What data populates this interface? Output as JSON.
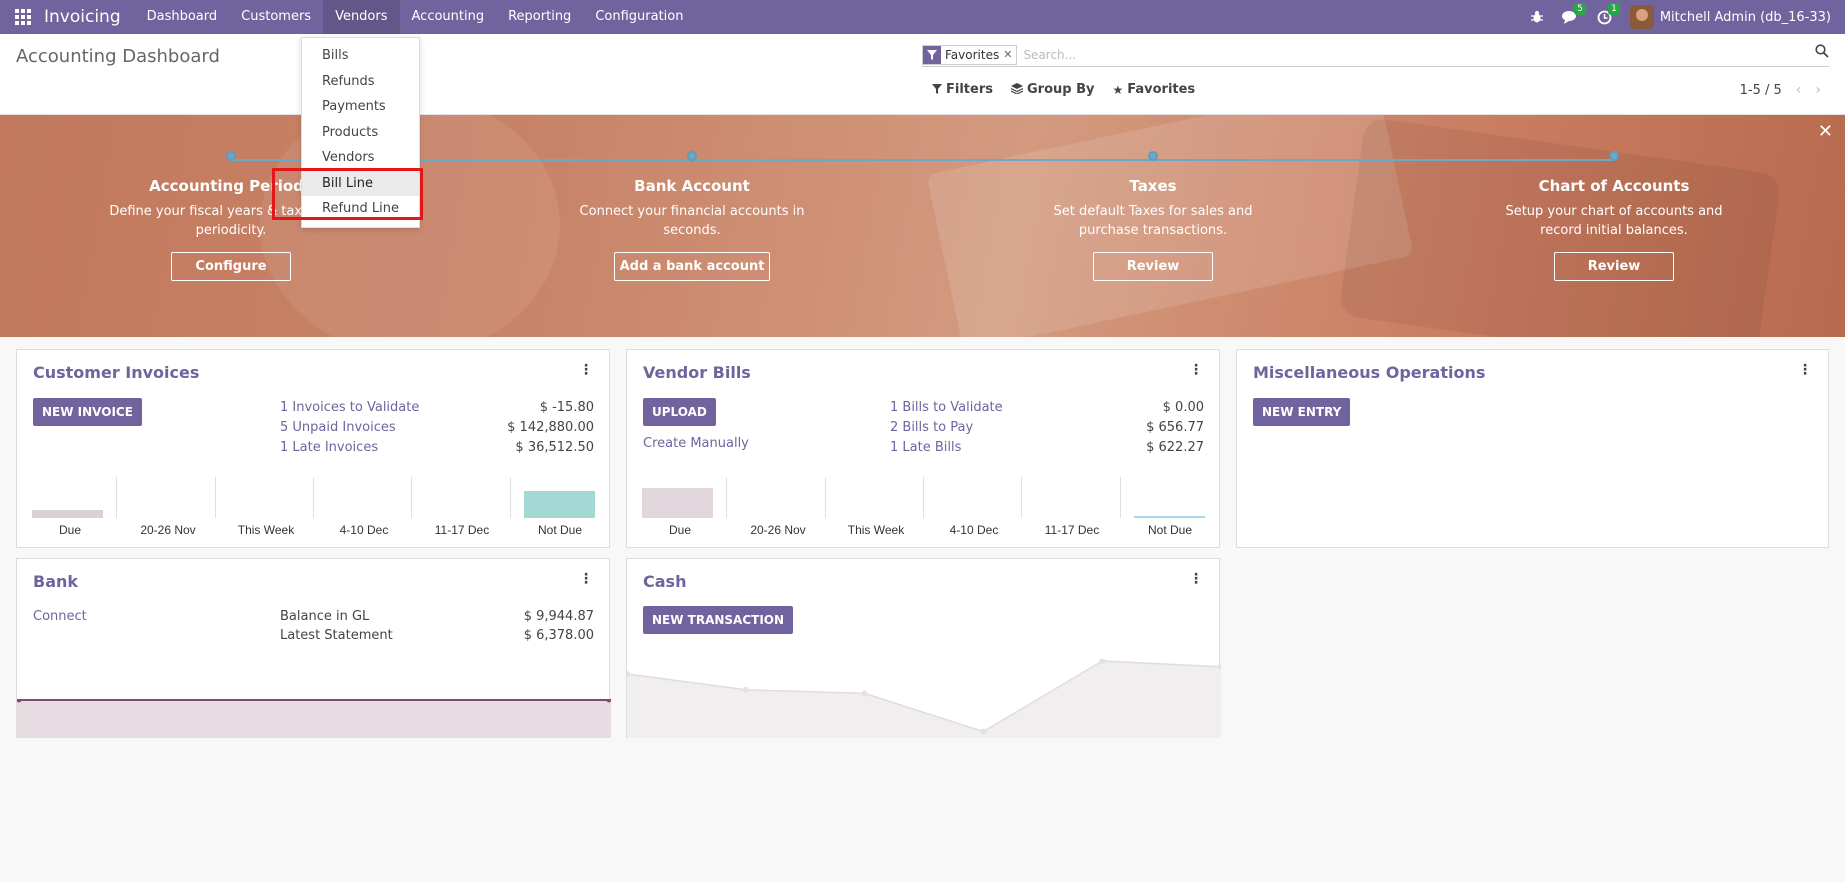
{
  "navbar": {
    "brand": "Invoicing",
    "menu": [
      "Dashboard",
      "Customers",
      "Vendors",
      "Accounting",
      "Reporting",
      "Configuration"
    ],
    "messages_count": "5",
    "activities_count": "1",
    "user": "Mitchell Admin (db_16-33)"
  },
  "control_panel": {
    "title": "Accounting Dashboard",
    "facet": "Favorites",
    "search_placeholder": "Search...",
    "filters": "Filters",
    "group_by": "Group By",
    "favorites": "Favorites",
    "pager": "1-5 / 5"
  },
  "vendors_menu": {
    "items": [
      "Bills",
      "Refunds",
      "Payments",
      "Products",
      "Vendors",
      "Bill Line",
      "Refund Line"
    ],
    "hovered": "Bill Line"
  },
  "onboarding": {
    "steps": [
      {
        "title": "Accounting Periods",
        "desc": "Define your fiscal years & tax returns periodicity.",
        "button": "Configure"
      },
      {
        "title": "Bank Account",
        "desc": "Connect your financial accounts in seconds.",
        "button": "Add a bank account"
      },
      {
        "title": "Taxes",
        "desc": "Set default Taxes for sales and purchase transactions.",
        "button": "Review"
      },
      {
        "title": "Chart of Accounts",
        "desc": "Setup your chart of accounts and record initial balances.",
        "button": "Review"
      }
    ]
  },
  "customer_invoices": {
    "title": "Customer Invoices",
    "button": "NEW INVOICE",
    "stats": [
      {
        "label": "1 Invoices to Validate",
        "value": "$ -15.80"
      },
      {
        "label": "5 Unpaid Invoices",
        "value": "$ 142,880.00"
      },
      {
        "label": "1 Late Invoices",
        "value": "$ 36,512.50"
      }
    ],
    "graph_labels": [
      "Due",
      "20-26 Nov",
      "This Week",
      "4-10 Dec",
      "11-17 Dec",
      "Not Due"
    ],
    "graph_bars": [
      0.2,
      0,
      0,
      0,
      0,
      0.65
    ],
    "graph_colors": [
      "#dcd0d8",
      "",
      "",
      "",
      "",
      "#a3d9d5"
    ]
  },
  "vendor_bills": {
    "title": "Vendor Bills",
    "button": "UPLOAD",
    "create_manually": "Create Manually",
    "stats": [
      {
        "label": "1 Bills to Validate",
        "value": "$ 0.00"
      },
      {
        "label": "2 Bills to Pay",
        "value": "$ 656.77"
      },
      {
        "label": "1 Late Bills",
        "value": "$ 622.27"
      }
    ],
    "graph_labels": [
      "Due",
      "20-26 Nov",
      "This Week",
      "4-10 Dec",
      "11-17 Dec",
      "Not Due"
    ],
    "graph_bars": [
      0.72,
      0,
      0,
      0,
      0,
      0.05
    ],
    "graph_colors": [
      "#e0d6dc",
      "",
      "",
      "",
      "",
      "#a3d9e8"
    ]
  },
  "misc_operations": {
    "title": "Miscellaneous Operations",
    "button": "NEW ENTRY"
  },
  "bank": {
    "title": "Bank",
    "connect": "Connect",
    "stats": [
      {
        "label": "Balance in GL",
        "value": "$ 9,944.87"
      },
      {
        "label": "Latest Statement",
        "value": "$ 6,378.00"
      }
    ]
  },
  "cash": {
    "title": "Cash",
    "button": "NEW TRANSACTION",
    "trend": [
      0.82,
      0.6,
      0.55,
      0.02,
      1.0,
      0.92
    ]
  }
}
